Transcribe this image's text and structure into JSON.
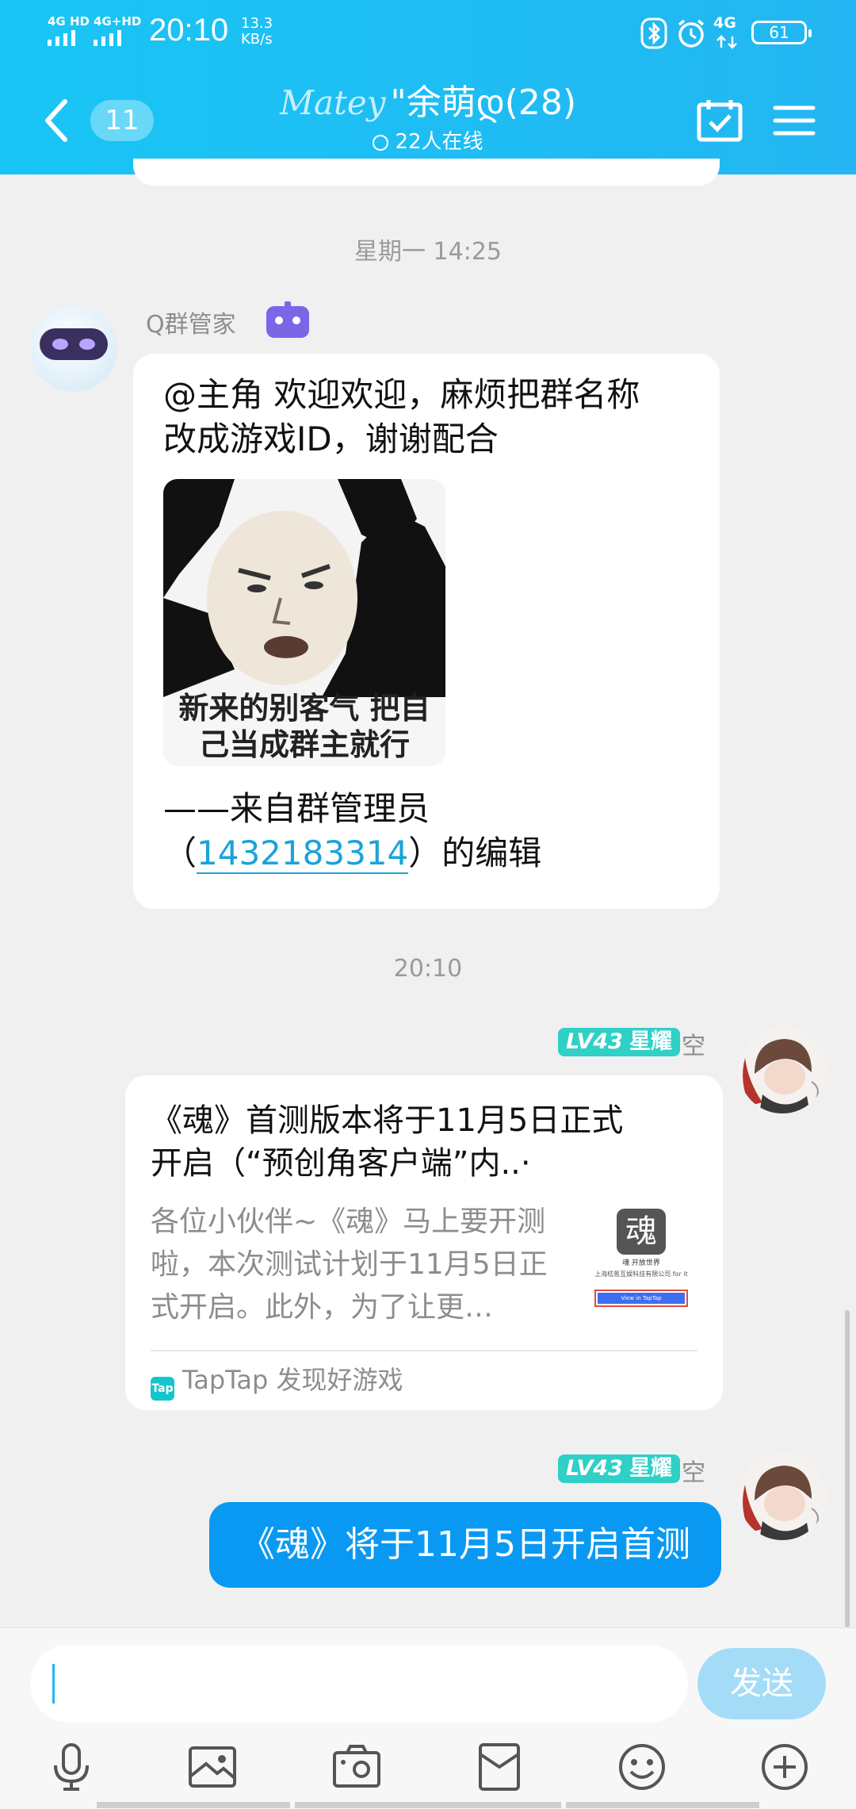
{
  "status_bar": {
    "sig1": "4G HD",
    "sig2": "4G+HD",
    "time": "20:10",
    "net_speed": "13.3",
    "net_unit": "KB/s",
    "net_type": "4G",
    "battery": "61"
  },
  "header": {
    "unread_count": "11",
    "brand": "Matey",
    "title": "\"余萌დ(28)",
    "online": "22人在线"
  },
  "messages": {
    "ts1": "星期一 14:25",
    "bot_name": "Q群管家",
    "bot_text_1": "@主角 欢迎欢迎，麻烦把群名称",
    "bot_text_2": "改成游戏ID，谢谢配合",
    "sticker_cap_1": "新来的别客气 把自",
    "sticker_cap_2": "己当成群主就行",
    "sig_prefix": "——来自群管理员",
    "sig_open": "（",
    "sig_id": "1432183314",
    "sig_close": "）的编辑",
    "ts2": "20:10",
    "user_level": "LV43",
    "user_rank": "星耀",
    "user_nick": "空",
    "card_title_1": "《魂》首测版本将于11月5日正式",
    "card_title_2": "开启（“预创角客户端”内..·",
    "card_desc_1": "各位小伙伴~《魂》马上要开测",
    "card_desc_2": "啦，本次测试计划于11月5日正",
    "card_desc_3": "式开启。此外，为了让更…",
    "thumb_logo": "魂",
    "thumb_sub": "魂 开放世界",
    "thumb_company": "上海桔氪互娱科技有限公司 for it",
    "thumb_btn": "View in TapTap",
    "card_source": "TapTap 发现好游戏",
    "tap_icon": "Tap",
    "user_message": "《魂》将于11月5日开启首测"
  },
  "input": {
    "send_label": "发送"
  },
  "colors": {
    "header": "#23b6f2",
    "bubble_blue": "#0a99f2",
    "level_badge": "#2fd0c5",
    "link": "#1aa3d8"
  }
}
